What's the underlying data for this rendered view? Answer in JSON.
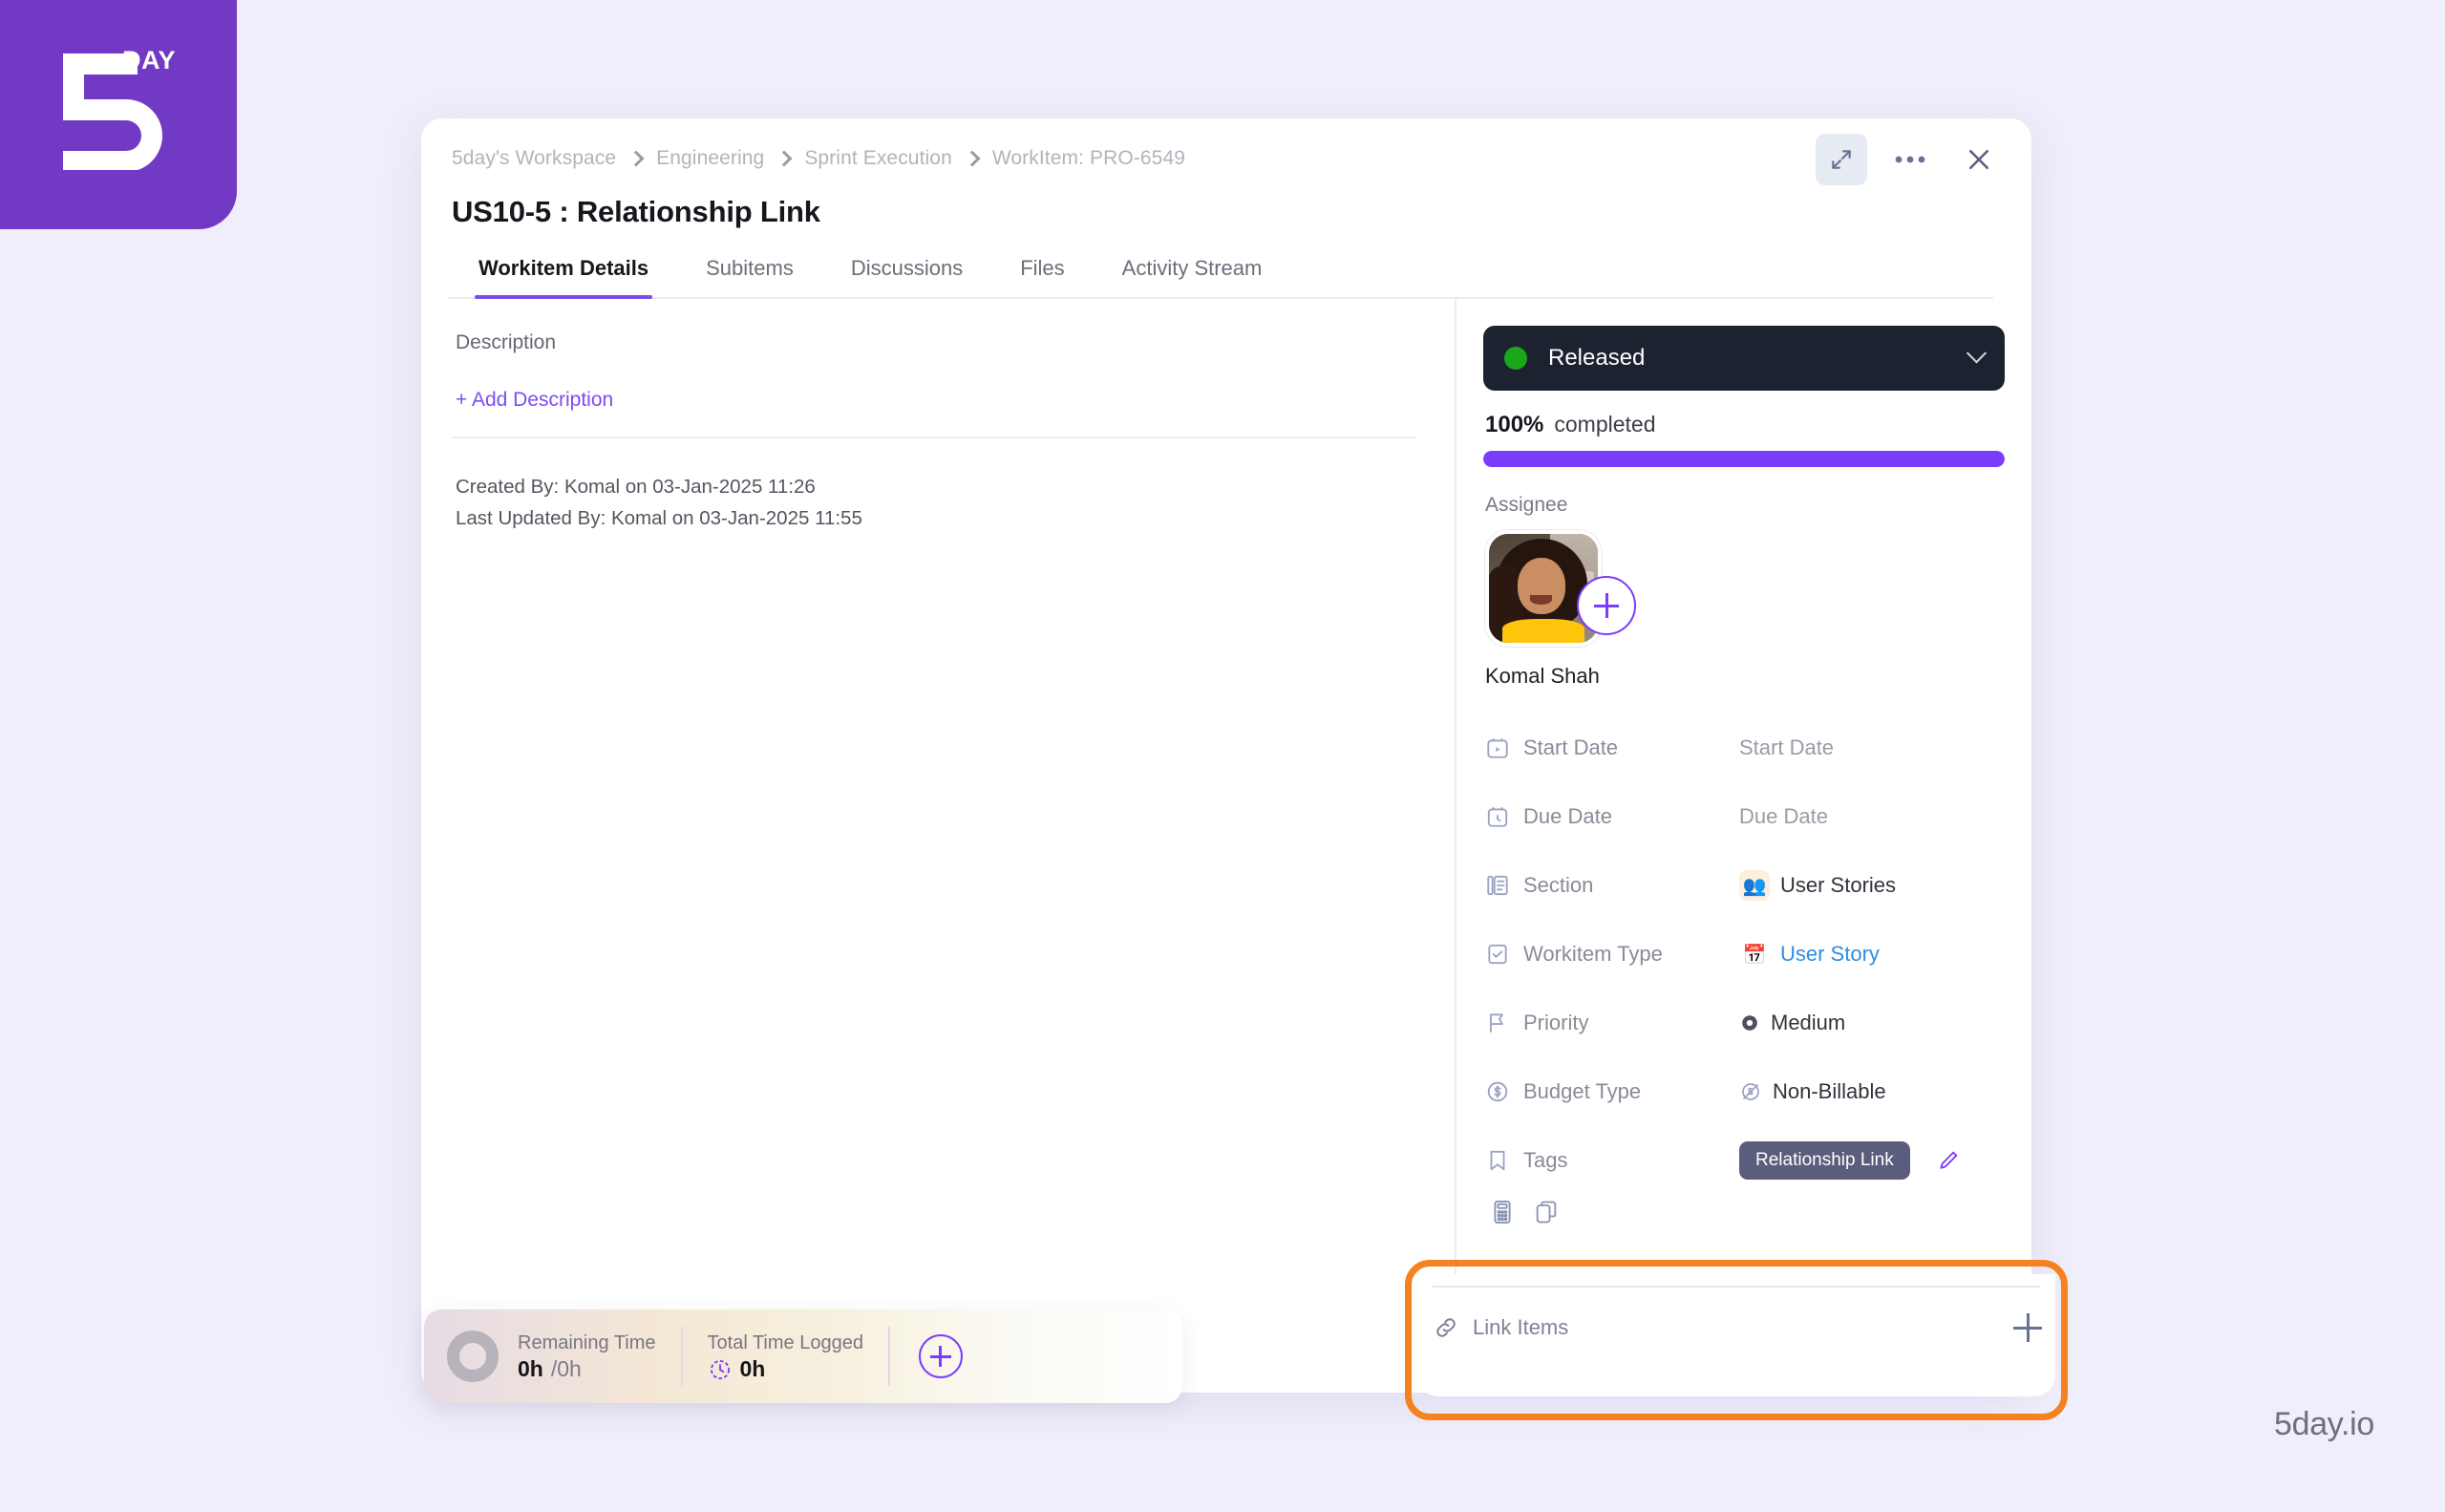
{
  "brand": {
    "logo_text": "DAY",
    "logo_numeral": "5",
    "logo_color": "#7239c4",
    "watermark": "5day.io"
  },
  "window": {
    "expand_icon": "expand-diagonal-icon",
    "more_icon": "ellipsis-icon",
    "close_icon": "close-x-icon"
  },
  "breadcrumb": {
    "items": [
      {
        "label": "5day's Workspace"
      },
      {
        "label": "Engineering"
      },
      {
        "label": "Sprint Execution"
      },
      {
        "label": "WorkItem: PRO-6549"
      }
    ]
  },
  "header": {
    "title": "US10-5 : Relationship Link"
  },
  "tabs": [
    {
      "label": "Workitem Details",
      "active": true
    },
    {
      "label": "Subitems",
      "active": false
    },
    {
      "label": "Discussions",
      "active": false
    },
    {
      "label": "Files",
      "active": false
    },
    {
      "label": "Activity Stream",
      "active": false
    }
  ],
  "description": {
    "label": "Description",
    "add_label": "+ Add Description"
  },
  "audit": {
    "created": "Created By: Komal on 03-Jan-2025 11:26",
    "updated": "Last Updated By: Komal on 03-Jan-2025 11:55"
  },
  "status": {
    "value": "Released",
    "dot_color": "#1aa81a",
    "chevron_icon": "chevron-down-icon"
  },
  "progress": {
    "percent_label": "100%",
    "completed_label": "completed",
    "percent_value": 100,
    "bar_color": "#7b3dfc"
  },
  "assignee": {
    "label": "Assignee",
    "name": "Komal Shah",
    "add_icon": "plus-circle-icon"
  },
  "properties": [
    {
      "icon": "start-date-icon",
      "label": "Start Date",
      "value": "Start Date",
      "style": "placeholder"
    },
    {
      "icon": "due-date-icon",
      "label": "Due Date",
      "value": "Due Date",
      "style": "placeholder"
    },
    {
      "icon": "section-icon",
      "label": "Section",
      "value": "User Stories",
      "emoji": "👥",
      "style": "normal"
    },
    {
      "icon": "workitem-type-icon",
      "label": "Workitem Type",
      "value": "User Story",
      "emoji": "📅",
      "style": "link"
    },
    {
      "icon": "flag-icon",
      "label": "Priority",
      "value": "Medium",
      "style": "normal"
    },
    {
      "icon": "dollar-circle-icon",
      "label": "Budget Type",
      "value": "Non-Billable",
      "style": "normal"
    }
  ],
  "tags": {
    "icon": "bookmark-icon",
    "label": "Tags",
    "chip": "Relationship Link",
    "chip_color": "#5b5d7d",
    "edit_icon": "pencil-icon"
  },
  "stub_icons": [
    {
      "name": "calculator-icon"
    },
    {
      "name": "copy-icon"
    }
  ],
  "link_items": {
    "icon": "link-chain-icon",
    "label": "Link Items",
    "add_icon": "plus-icon"
  },
  "highlight": {
    "color": "#f58220"
  },
  "time_tracking": {
    "remaining_label": "Remaining Time",
    "remaining_value": "0h",
    "remaining_total": "/0h",
    "logged_label": "Total Time Logged",
    "logged_value": "0h",
    "clock_icon": "clock-icon",
    "add_icon": "plus-circle-icon"
  }
}
